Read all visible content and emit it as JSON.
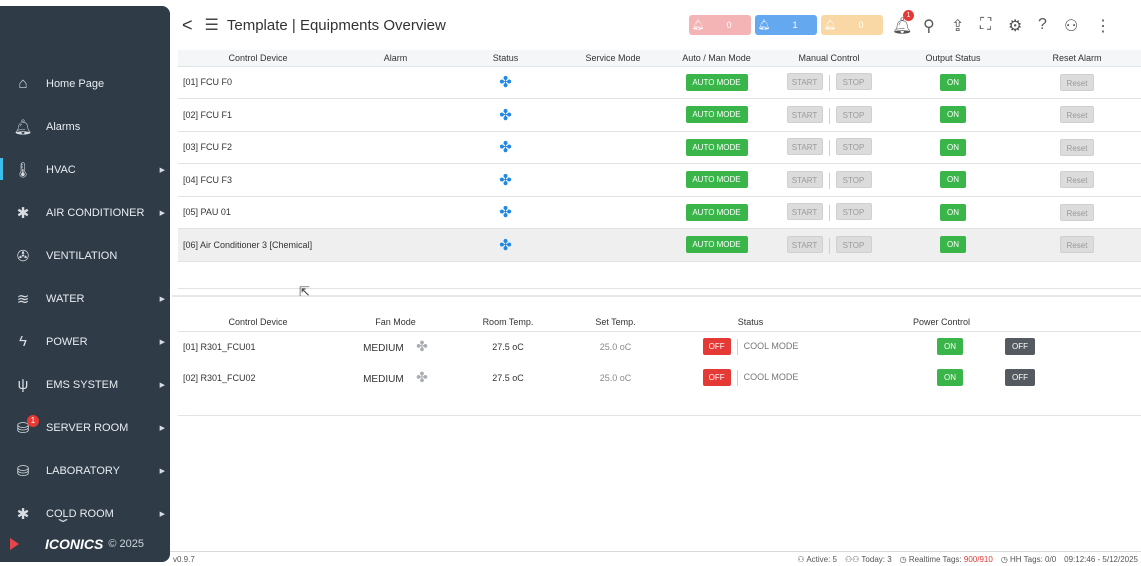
{
  "sidebar": {
    "items": [
      {
        "label": "Home Page",
        "icon": "home-icon",
        "glyph": "⌂",
        "arrow": false
      },
      {
        "label": "Alarms",
        "icon": "bell-icon",
        "glyph": "🔔︎",
        "arrow": false
      },
      {
        "label": "HVAC",
        "icon": "thermometer-icon",
        "glyph": "🌡︎",
        "arrow": true,
        "active": true
      },
      {
        "label": "AIR CONDITIONER",
        "icon": "snowflake-icon",
        "glyph": "✱",
        "arrow": true
      },
      {
        "label": "VENTILATION",
        "icon": "fan-icon",
        "glyph": "✇",
        "arrow": false
      },
      {
        "label": "WATER",
        "icon": "water-icon",
        "glyph": "≋",
        "arrow": true
      },
      {
        "label": "POWER",
        "icon": "lightning-icon",
        "glyph": "ϟ",
        "arrow": true
      },
      {
        "label": "EMS SYSTEM",
        "icon": "plug-icon",
        "glyph": "ψ",
        "arrow": true
      },
      {
        "label": "SERVER ROOM",
        "icon": "database-icon",
        "glyph": "⛁",
        "arrow": true,
        "badge": "1"
      },
      {
        "label": "LABORATORY",
        "icon": "database-icon",
        "glyph": "⛁",
        "arrow": true
      },
      {
        "label": "COLD ROOM",
        "icon": "snowflake-icon",
        "glyph": "✱",
        "arrow": true
      }
    ],
    "brand": "ICONICS",
    "copyright": "© 2025"
  },
  "header": {
    "title": "Template | Equipments Overview",
    "alarm_counts": [
      "0",
      "1",
      "0"
    ],
    "notification_badge": "1"
  },
  "equipment_table": {
    "columns": [
      "Control Device",
      "Alarm",
      "Status",
      "Service Mode",
      "Auto / Man Mode",
      "Manual Control",
      "Output Status",
      "Reset Alarm"
    ],
    "rows": [
      {
        "device": "[01] FCU F0",
        "mode": "AUTO MODE",
        "start": "START",
        "stop": "STOP",
        "output": "ON",
        "reset": "Reset"
      },
      {
        "device": "[02] FCU F1",
        "mode": "AUTO MODE",
        "start": "START",
        "stop": "STOP",
        "output": "ON",
        "reset": "Reset"
      },
      {
        "device": "[03] FCU F2",
        "mode": "AUTO MODE",
        "start": "START",
        "stop": "STOP",
        "output": "ON",
        "reset": "Reset"
      },
      {
        "device": "[04] FCU F3",
        "mode": "AUTO MODE",
        "start": "START",
        "stop": "STOP",
        "output": "ON",
        "reset": "Reset"
      },
      {
        "device": "[05] PAU 01",
        "mode": "AUTO MODE",
        "start": "START",
        "stop": "STOP",
        "output": "ON",
        "reset": "Reset"
      },
      {
        "device": "[06] Air Conditioner 3 [Chemical]",
        "mode": "AUTO MODE",
        "start": "START",
        "stop": "STOP",
        "output": "ON",
        "reset": "Reset"
      }
    ]
  },
  "fcu_table": {
    "columns": [
      "Control Device",
      "Fan Mode",
      "Room Temp.",
      "Set Temp.",
      "Status",
      "Power Control"
    ],
    "rows": [
      {
        "device": "[01] R301_FCU01",
        "fan_mode": "MEDIUM",
        "room_temp": "27.5 oC",
        "set_temp": "25.0 oC",
        "status": "OFF",
        "mode": "COOL MODE",
        "on": "ON",
        "off": "OFF"
      },
      {
        "device": "[02] R301_FCU02",
        "fan_mode": "MEDIUM",
        "room_temp": "27.5 oC",
        "set_temp": "25.0 oC",
        "status": "OFF",
        "mode": "COOL MODE",
        "on": "ON",
        "off": "OFF"
      }
    ]
  },
  "statusbar": {
    "version": "v0.9.7",
    "active": "Active: 5",
    "today": "Today: 3",
    "realtime_label": "Realtime Tags:",
    "realtime_value": "900/910",
    "hh_label": "HH Tags:",
    "hh_value": "0/0",
    "datetime": "09:12:46 - 5/12/2025"
  },
  "colors": {
    "sidebar": "#2f3b47",
    "accent_green": "#3ab54a",
    "accent_red": "#e53935",
    "accent_blue": "#1e88e5"
  }
}
